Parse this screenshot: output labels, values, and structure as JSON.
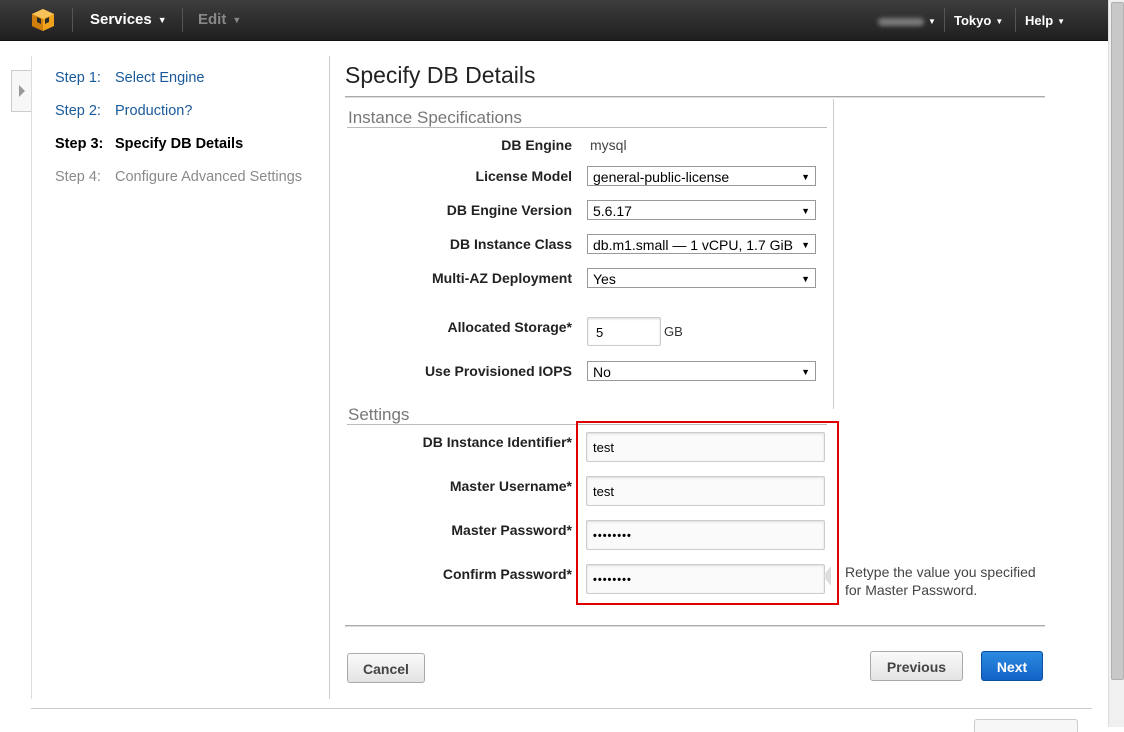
{
  "topnav": {
    "services_label": "Services",
    "edit_label": "Edit",
    "region_label": "Tokyo",
    "help_label": "Help"
  },
  "steps": [
    {
      "num": "Step 1:",
      "label": "Select Engine"
    },
    {
      "num": "Step 2:",
      "label": "Production?"
    },
    {
      "num": "Step 3:",
      "label": "Specify DB Details"
    },
    {
      "num": "Step 4:",
      "label": "Configure Advanced Settings"
    }
  ],
  "page": {
    "title": "Specify DB Details"
  },
  "instance_specs": {
    "section_title": "Instance Specifications",
    "db_engine_label": "DB Engine",
    "db_engine_value": "mysql",
    "license_model_label": "License Model",
    "license_model_value": "general-public-license",
    "engine_version_label": "DB Engine Version",
    "engine_version_value": "5.6.17",
    "instance_class_label": "DB Instance Class",
    "instance_class_value": "db.m1.small — 1 vCPU, 1.7 GiB",
    "multi_az_label": "Multi-AZ Deployment",
    "multi_az_value": "Yes",
    "storage_label": "Allocated Storage*",
    "storage_value": "5",
    "storage_unit": "GB",
    "piops_label": "Use Provisioned IOPS",
    "piops_value": "No"
  },
  "settings": {
    "section_title": "Settings",
    "identifier_label": "DB Instance Identifier*",
    "identifier_value": "test",
    "username_label": "Master Username*",
    "username_value": "test",
    "password_label": "Master Password*",
    "password_value": "••••••••",
    "confirm_label": "Confirm Password*",
    "confirm_value": "••••••••",
    "confirm_hint": "Retype the value you specified for Master Password."
  },
  "buttons": {
    "cancel": "Cancel",
    "previous": "Previous",
    "next": "Next"
  },
  "colors": {
    "primary_button": "#1463c7",
    "highlight_box": "#e00000",
    "link": "#1a5a9a"
  }
}
